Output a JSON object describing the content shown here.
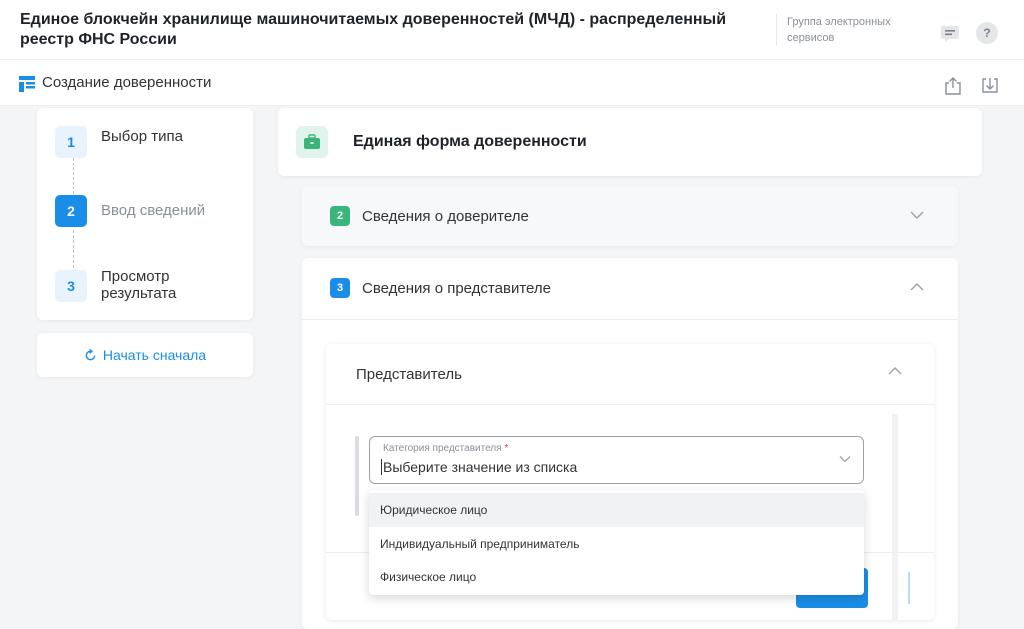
{
  "header": {
    "title": "Единое блокчейн хранилище машиночитаемых доверенностей (МЧД) - распределенный реестр ФНС России",
    "group_link": "Группа электронных сервисов",
    "chat_icon": "chat-icon",
    "help_label": "?"
  },
  "subheader": {
    "title": "Создание доверенности",
    "share_icon": "share-icon",
    "download_icon": "download-icon"
  },
  "steps": [
    {
      "num": "1",
      "label": "Выбор типа"
    },
    {
      "num": "2",
      "label": "Ввод сведений"
    },
    {
      "num": "3",
      "label": "Просмотр результата"
    }
  ],
  "restart": {
    "label": "Начать сначала"
  },
  "form": {
    "title": "Единая форма доверенности"
  },
  "sections": [
    {
      "num": "2",
      "label": "Сведения о доверителе"
    },
    {
      "num": "3",
      "label": "Сведения о представителе"
    }
  ],
  "representative": {
    "title": "Представитель",
    "select": {
      "label": "Категория представителя",
      "required_mark": "*",
      "value": "Выберите значение из списка"
    },
    "options": [
      "Юридическое лицо",
      "Индивидуальный предприниматель",
      "Физическое лицо"
    ]
  },
  "colors": {
    "accent": "#1a8ee6",
    "success": "#3ab67a"
  }
}
